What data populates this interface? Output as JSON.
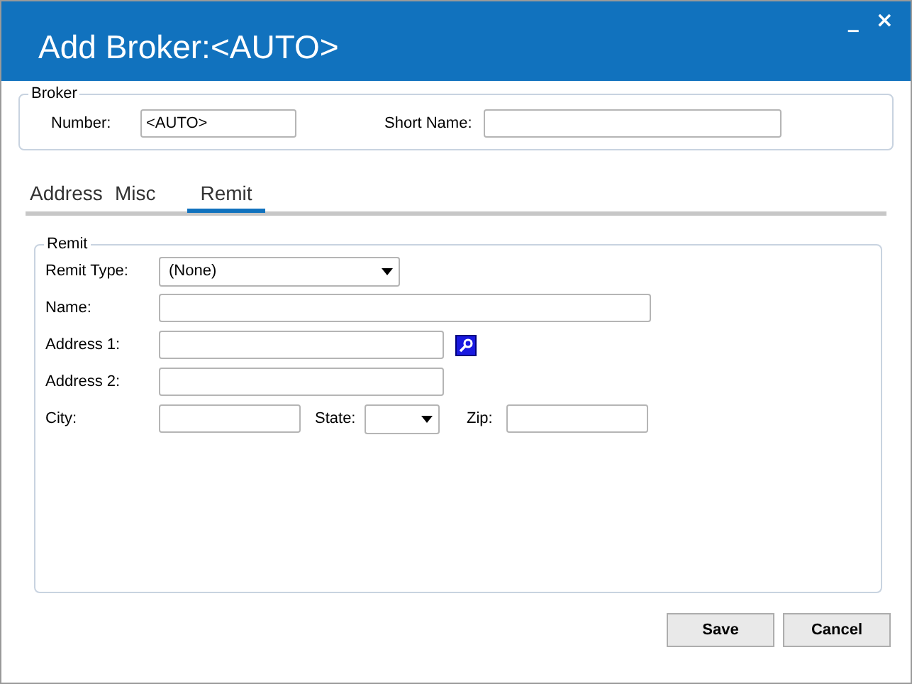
{
  "window": {
    "title": "Add Broker:<AUTO>",
    "controls": [
      "_",
      "×"
    ]
  },
  "broker": {
    "legend": "Broker",
    "number": {
      "label": "Number:",
      "value": "<AUTO>"
    },
    "short_name": {
      "label": "Short Name:"
    }
  },
  "tabs": [
    {
      "label": "Address",
      "selected": false
    },
    {
      "label": "Misc",
      "selected": false
    },
    {
      "label": "Remit",
      "selected": true
    }
  ],
  "remit": {
    "legend": "Remit",
    "remit_type": {
      "label": "Remit Type:",
      "value": "(None)"
    },
    "name": {
      "label": "Name:"
    },
    "address_1": {
      "label": "Address 1:"
    },
    "address_2": {
      "label": "Address 2:"
    },
    "city": {
      "label": "City:"
    },
    "state": {
      "label": "State:"
    },
    "zip": {
      "label": "Zip:"
    }
  },
  "buttons": [
    "Save",
    "Cancel"
  ]
}
